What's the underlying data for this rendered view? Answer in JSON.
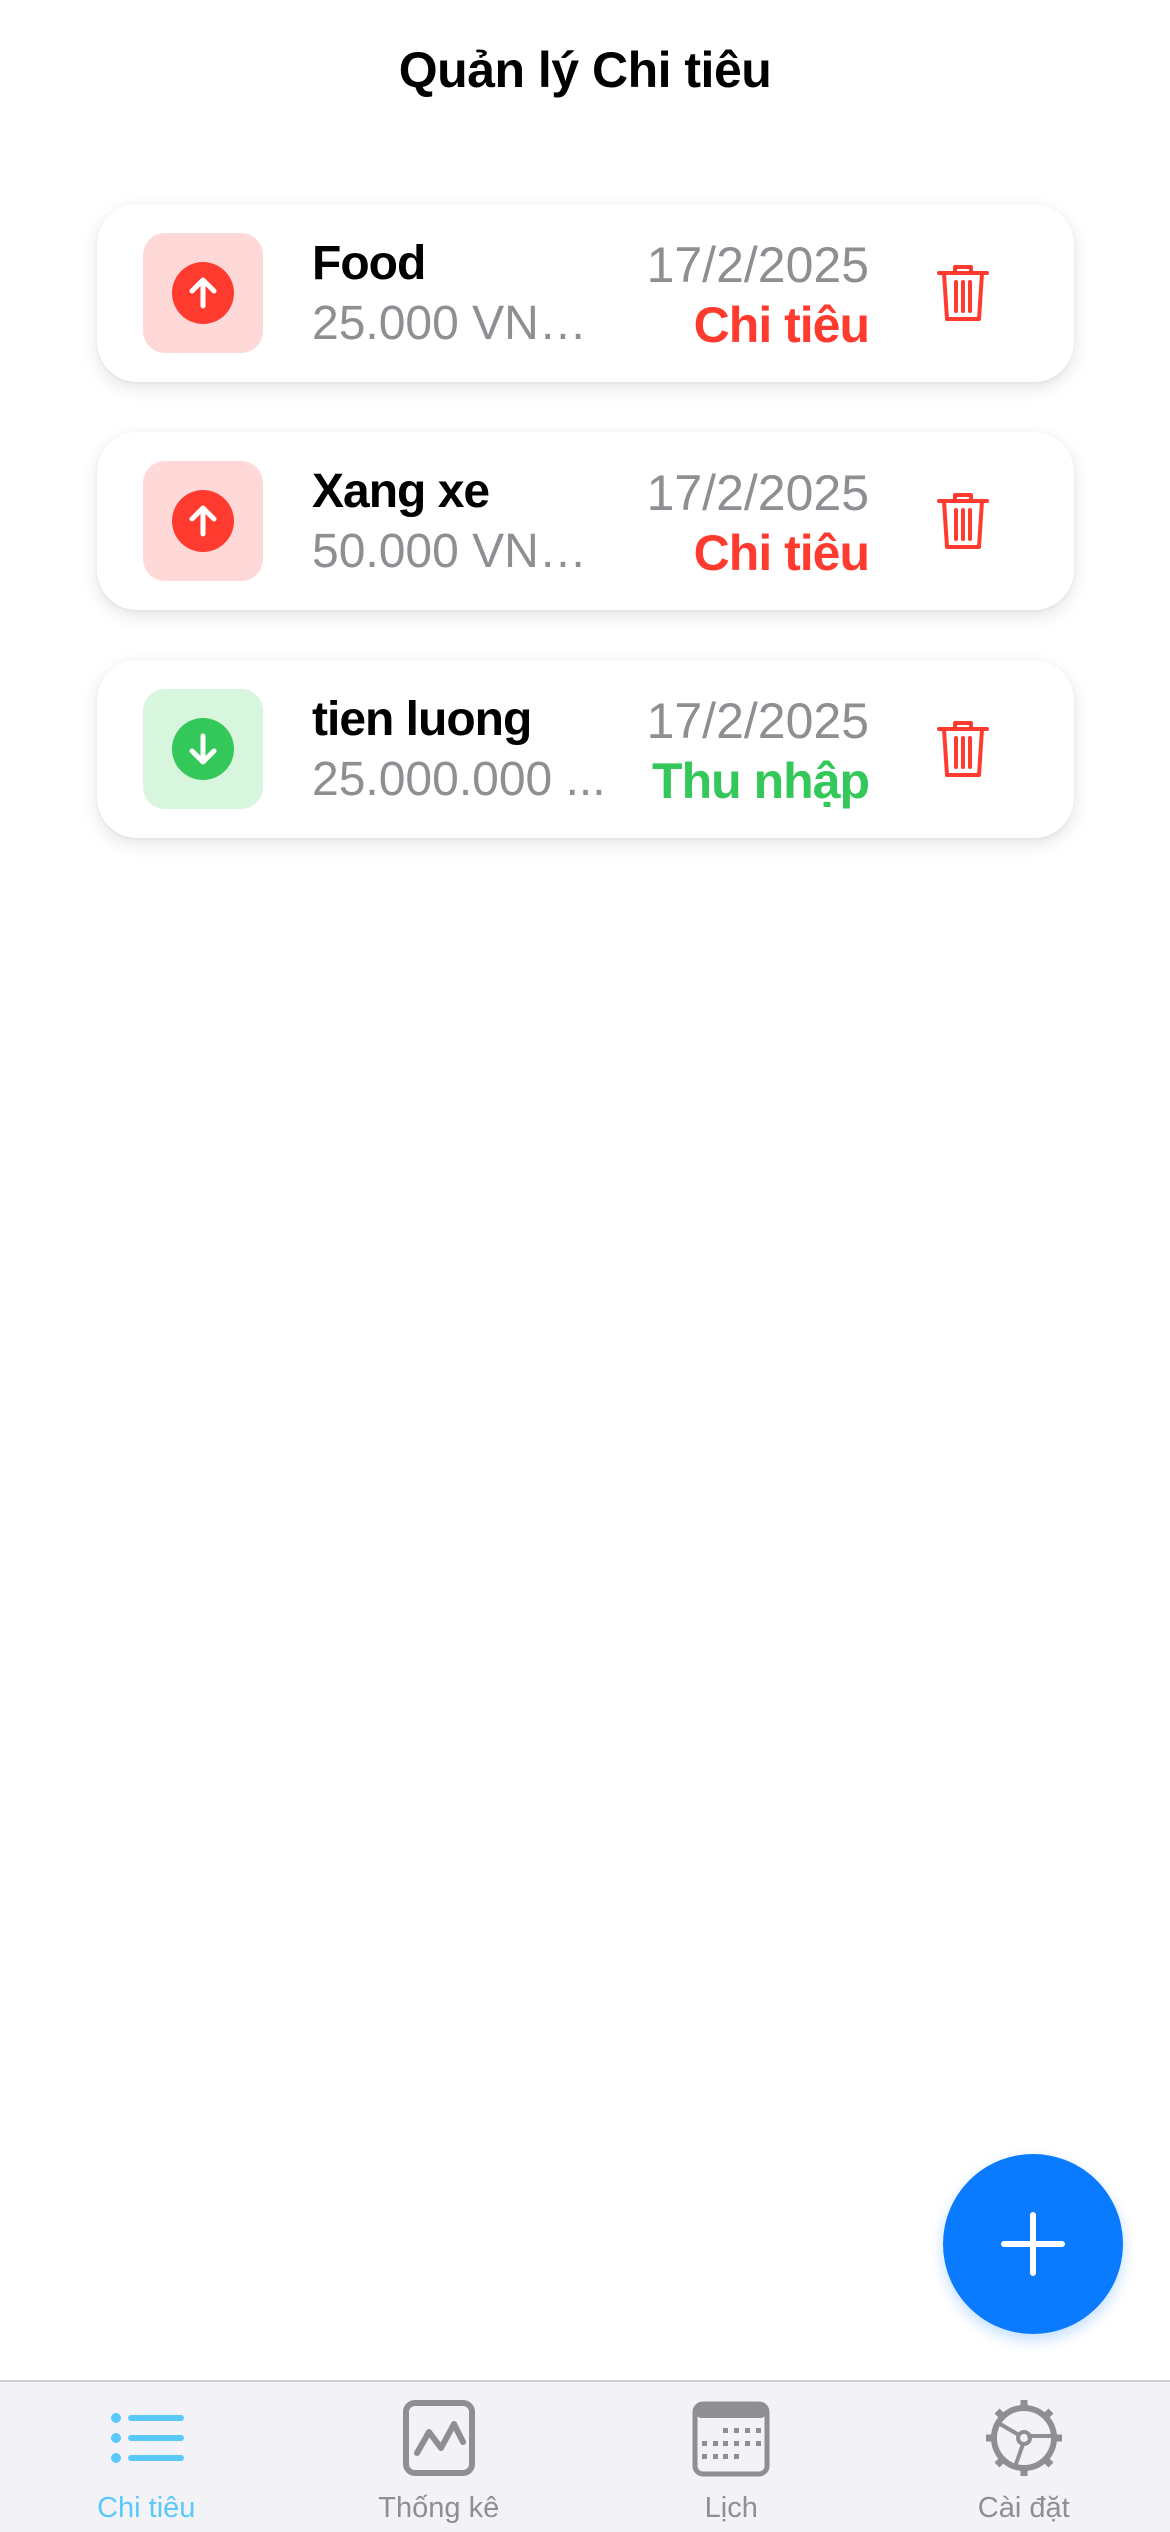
{
  "header": {
    "title": "Quản lý Chi tiêu"
  },
  "transactions": [
    {
      "name": "Food",
      "amount": "25.000 VNĐ...",
      "date": "17/2/2025",
      "type_label": "Chi tiêu",
      "kind": "expense",
      "icon": "arrow-up-circle-icon"
    },
    {
      "name": "Xang xe",
      "amount": "50.000 VNĐ...",
      "date": "17/2/2025",
      "type_label": "Chi tiêu",
      "kind": "expense",
      "icon": "arrow-up-circle-icon"
    },
    {
      "name": "tien luong",
      "amount": "25.000.000 ...",
      "date": "17/2/2025",
      "type_label": "Thu nhập",
      "kind": "income",
      "icon": "arrow-down-circle-icon"
    }
  ],
  "fab": {
    "icon": "plus-icon"
  },
  "tabbar": {
    "tabs": [
      {
        "label": "Chi tiêu",
        "icon": "list-icon",
        "active": true
      },
      {
        "label": "Thống kê",
        "icon": "chart-icon",
        "active": false
      },
      {
        "label": "Lịch",
        "icon": "calendar-icon",
        "active": false
      },
      {
        "label": "Cài đặt",
        "icon": "gear-icon",
        "active": false
      }
    ]
  },
  "colors": {
    "expense": "#ff3b30",
    "income": "#34c759",
    "accent": "#0a7aff",
    "tab_active": "#5ac8fa",
    "muted": "#8e8e93"
  }
}
